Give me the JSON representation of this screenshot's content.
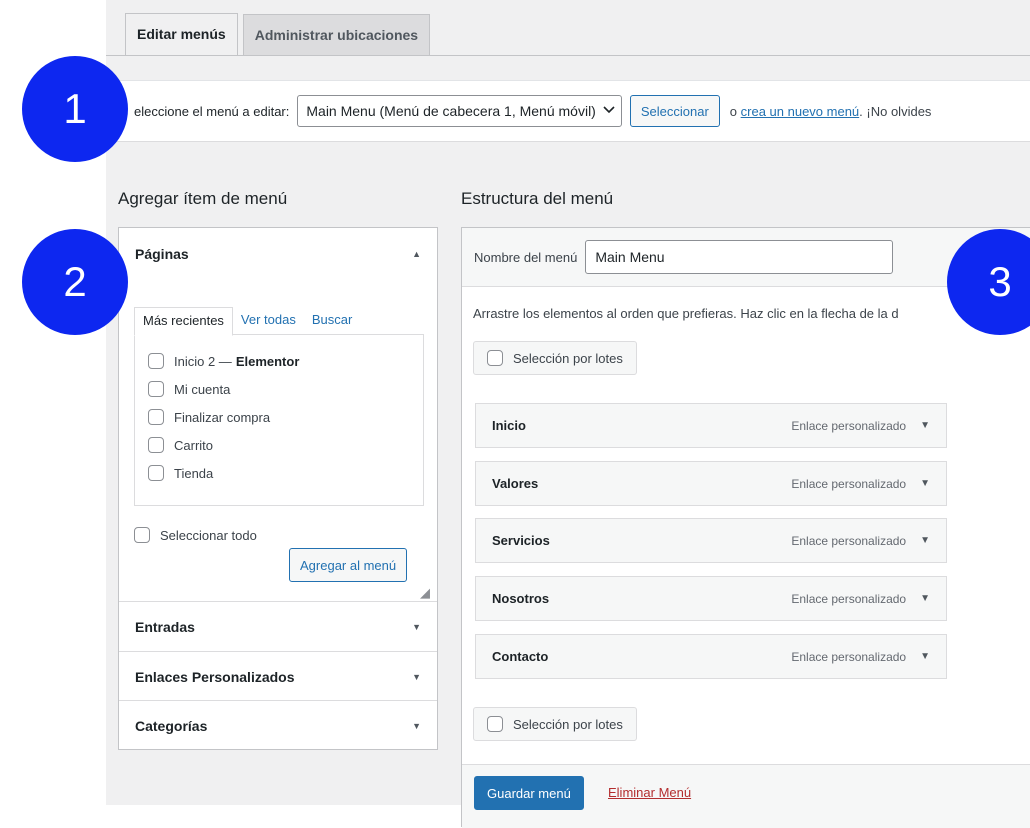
{
  "tabs": [
    {
      "label": "Editar menús",
      "active": true
    },
    {
      "label": "Administrar ubicaciones",
      "active": false
    }
  ],
  "manage": {
    "label": "eleccione el menú a editar:",
    "selected_menu": "Main Menu (Menú de cabecera 1, Menú móvil)",
    "select_button": "Seleccionar",
    "or_text": "o",
    "create_link": "crea un nuevo menú",
    "after_text": ". ¡No olvides"
  },
  "left": {
    "heading": "Agregar ítem de menú",
    "pages_title": "Páginas",
    "sub_tabs": [
      "Más recientes",
      "Ver todas",
      "Buscar"
    ],
    "pages": [
      {
        "label": "Inicio 2 —",
        "suffix": "Elementor"
      },
      {
        "label": "Mi cuenta",
        "suffix": ""
      },
      {
        "label": "Finalizar compra",
        "suffix": ""
      },
      {
        "label": "Carrito",
        "suffix": ""
      },
      {
        "label": "Tienda",
        "suffix": ""
      }
    ],
    "select_all": "Seleccionar todo",
    "add_button": "Agregar al menú",
    "sections": [
      "Entradas",
      "Enlaces Personalizados",
      "Categorías"
    ]
  },
  "right": {
    "heading": "Estructura del menú",
    "name_label": "Nombre del menú",
    "name_value": "Main Menu",
    "instructions": "Arrastre los elementos al orden que prefieras. Haz clic en la flecha de la d",
    "bulk_label": "Selección por lotes",
    "items": [
      {
        "title": "Inicio",
        "type": "Enlace personalizado"
      },
      {
        "title": "Valores",
        "type": "Enlace personalizado"
      },
      {
        "title": "Servicios",
        "type": "Enlace personalizado"
      },
      {
        "title": "Nosotros",
        "type": "Enlace personalizado"
      },
      {
        "title": "Contacto",
        "type": "Enlace personalizado"
      }
    ],
    "save_button": "Guardar menú",
    "delete_link": "Eliminar Menú"
  },
  "callouts": [
    "1",
    "2",
    "3"
  ],
  "colors": {
    "callout": "#0d27f0",
    "primary": "#2271b1",
    "danger": "#b32d2e"
  }
}
